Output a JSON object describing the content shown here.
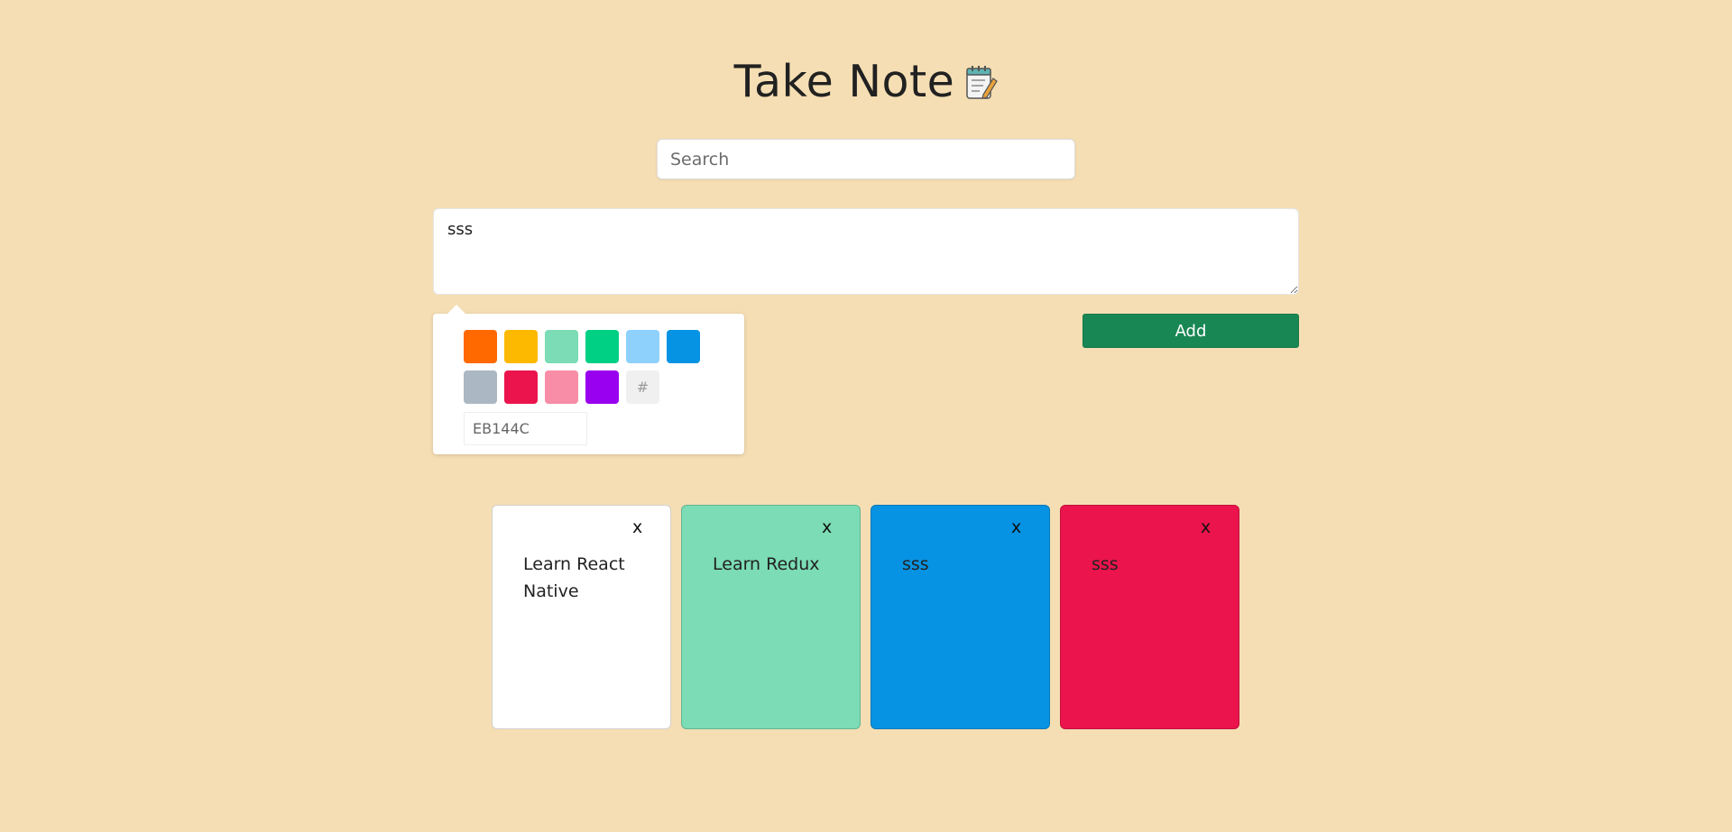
{
  "header": {
    "title": "Take Note",
    "icon": "notepad-pencil-icon"
  },
  "search": {
    "placeholder": "Search",
    "value": ""
  },
  "composer": {
    "text": "sss"
  },
  "color_picker": {
    "swatches": [
      "#FF6900",
      "#FCB900",
      "#7BDCB5",
      "#00D084",
      "#8ED1FC",
      "#0693E3",
      "#ABB8C3",
      "#EB144C",
      "#F78DA7",
      "#9900EF"
    ],
    "hash_label": "#",
    "hex_value": "EB144C"
  },
  "add_button": {
    "label": "Add"
  },
  "notes": [
    {
      "text": "Learn React Native",
      "color": "#FFFFFF",
      "close": "x"
    },
    {
      "text": "Learn Redux",
      "color": "#7BDCB5",
      "close": "x"
    },
    {
      "text": "sss",
      "color": "#0693E3",
      "close": "x"
    },
    {
      "text": "sss",
      "color": "#EB144C",
      "close": "x"
    }
  ],
  "colors": {
    "background": "#F5DEB3",
    "add_button": "#198754"
  }
}
